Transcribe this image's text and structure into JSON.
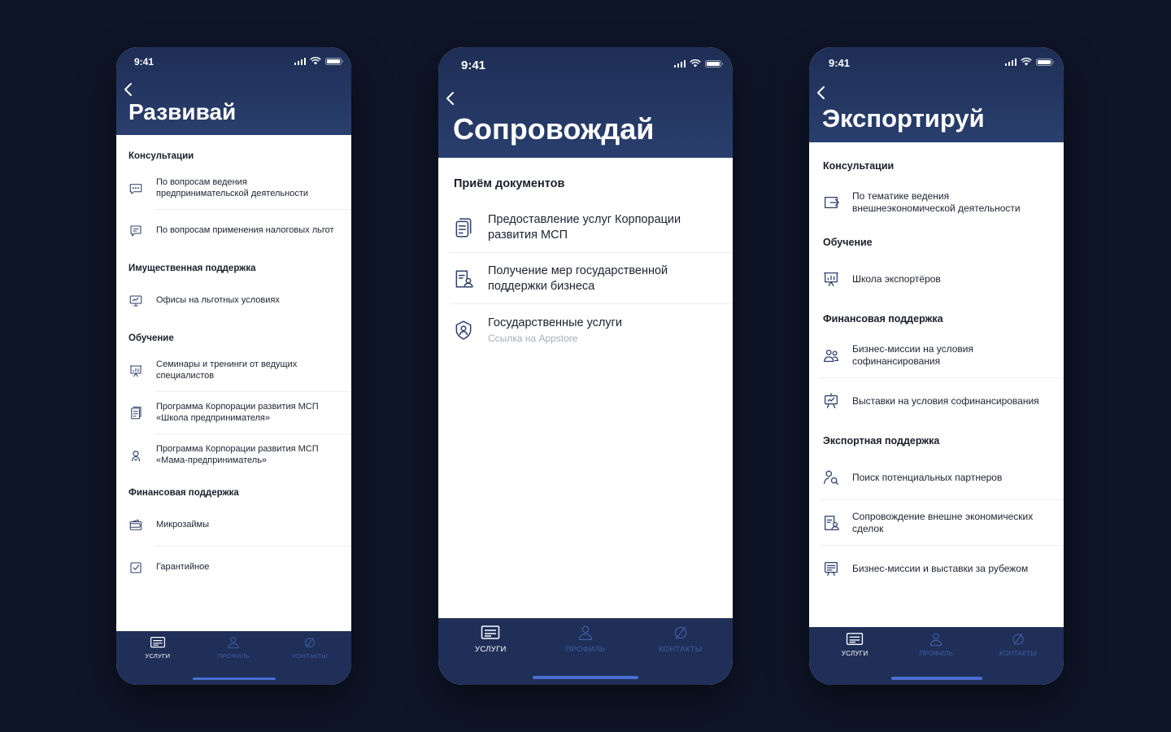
{
  "colors": {
    "background": "#0e1527",
    "header": "#1e2e55",
    "tabbar": "#1f2f58",
    "tab_inactive": "#3f5ea4",
    "icon": "#2c3f6b",
    "home_indicator": "#4a6ed1"
  },
  "status_bar": {
    "time": "9:41"
  },
  "screens": [
    {
      "title": "Развивай",
      "sections": [
        {
          "title": "Консультации",
          "items": [
            {
              "label": "По вопросам ведения предпринимательской деятельности",
              "icon": "chat-icon"
            },
            {
              "label": "По вопросам применения налоговых льгот",
              "icon": "message-icon"
            }
          ]
        },
        {
          "title": "Имущественная поддержка",
          "items": [
            {
              "label": "Офисы на льготных условиях",
              "icon": "monitor-icon"
            }
          ]
        },
        {
          "title": "Обучение",
          "items": [
            {
              "label": "Семинары и тренинги от ведущих специалистов",
              "icon": "presentation-icon"
            },
            {
              "label": "Программа Корпорации развития МСП «Школа предпринимателя»",
              "icon": "document-icon"
            },
            {
              "label": "Программа Корпорации развития МСП «Мама-предприниматель»",
              "icon": "woman-icon"
            }
          ]
        },
        {
          "title": "Финансовая поддержка",
          "items": [
            {
              "label": "Микрозаймы",
              "icon": "wallet-icon"
            },
            {
              "label": "Гарантийное",
              "icon": "checkmark-icon"
            }
          ]
        }
      ]
    },
    {
      "title": "Сопровождай",
      "sections": [
        {
          "title": "Приём документов",
          "items": [
            {
              "label": "Предоставление услуг Корпорации развития МСП",
              "icon": "documents-icon"
            },
            {
              "label": "Получение мер государственной поддержки бизнеса",
              "icon": "person-document-icon"
            },
            {
              "label": "Государственные услуги",
              "sublabel": "Ссылка на Appstore",
              "icon": "user-shield-icon"
            }
          ]
        }
      ]
    },
    {
      "title": "Экспортируй",
      "sections": [
        {
          "title": "Консультации",
          "items": [
            {
              "label": "По тематике ведения внешнеэкономической деятельности",
              "icon": "export-icon"
            }
          ]
        },
        {
          "title": "Обучение",
          "items": [
            {
              "label": "Школа экспортёров",
              "icon": "presentation-icon"
            }
          ]
        },
        {
          "title": "Финансовая поддержка",
          "items": [
            {
              "label": "Бизнес-миссии на условия софинансирования",
              "icon": "people-icon"
            },
            {
              "label": "Выставки на условия софинансирования",
              "icon": "easel-icon"
            }
          ]
        },
        {
          "title": "Экспортная поддержка",
          "items": [
            {
              "label": "Поиск потенциальных партнеров",
              "icon": "person-search-icon"
            },
            {
              "label": "Сопровождение внешне экономических сделок",
              "icon": "person-document-icon"
            },
            {
              "label": "Бизнес-миссии и выставки за рубежом",
              "icon": "board-icon"
            }
          ]
        }
      ]
    }
  ],
  "tabbar": [
    {
      "label": "услуги",
      "icon": "services-icon",
      "active": true
    },
    {
      "label": "профиль",
      "icon": "profile-icon",
      "active": false
    },
    {
      "label": "контакты",
      "icon": "contacts-icon",
      "active": false
    }
  ]
}
